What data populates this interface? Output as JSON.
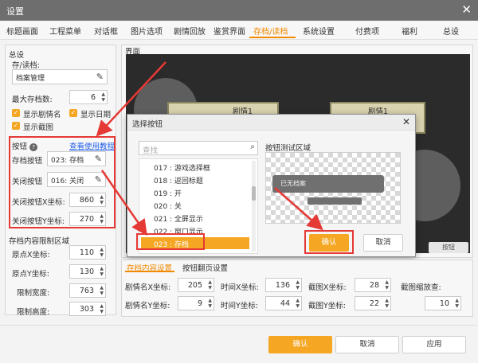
{
  "window": {
    "title": "设置",
    "close_icon": "✕"
  },
  "tabs": [
    {
      "label": "标题画面"
    },
    {
      "label": "工程菜单"
    },
    {
      "label": "对话框"
    },
    {
      "label": "图片选项"
    },
    {
      "label": "剧情回放"
    },
    {
      "label": "鉴赏界面"
    },
    {
      "label": "存档/读档"
    },
    {
      "label": "系统设置"
    },
    {
      "label": "付费项"
    },
    {
      "label": "福利"
    },
    {
      "label": "总设"
    }
  ],
  "active_tab": "存档/读档",
  "left": {
    "section_general": "总设",
    "save_load_label": "存/读档:",
    "save_load_value": "档案管理",
    "max_saves_label": "最大存档数:",
    "max_saves_value": "6",
    "checks": {
      "show_name": "显示剧情名",
      "show_date": "显示日期",
      "show_thumb": "显示截图"
    },
    "button_section": "按钮",
    "help_link": "查看使用教程",
    "save_button_label": "存档按钮",
    "save_button_value": "023: 存档",
    "close_button_label": "关闭按钮",
    "close_button_value": "016: 关闭",
    "close_x_label": "关闭按钮X坐标:",
    "close_x_value": "860",
    "close_y_label": "关闭按钮Y坐标:",
    "close_y_value": "270",
    "limit_section": "存档内容限制区域",
    "origin_x_label": "原点X坐标:",
    "origin_x_value": "110",
    "origin_y_label": "原点Y坐标:",
    "origin_y_value": "130",
    "limit_w_label": "限制宽度:",
    "limit_w_value": "763",
    "limit_h_label": "限制高度:",
    "limit_h_value": "303"
  },
  "preview": {
    "section": "界面",
    "card1": "剧情1",
    "card2": "剧情1",
    "corner_label": "按钮"
  },
  "dialog": {
    "title": "选择按钮",
    "close_icon": "✕",
    "search_placeholder": "查找",
    "search_icon": "🔍",
    "items": [
      {
        "label": "017 : 游戏选择框"
      },
      {
        "label": "018 : 返回标题"
      },
      {
        "label": "019 : 开"
      },
      {
        "label": "020 : 关"
      },
      {
        "label": "021 : 全屏显示"
      },
      {
        "label": "022 : 窗口显示"
      },
      {
        "label": "023 : 存档"
      }
    ],
    "selected": "023 : 存档",
    "test_area_label": "按钮测试区域",
    "test_button_text": "已无档案",
    "confirm": "确认",
    "cancel": "取消"
  },
  "subtabs": {
    "tab1": "存档内容设置",
    "tab2": "按钮翻页设置",
    "row1": [
      {
        "label": "剧情名X坐标:",
        "value": "205"
      },
      {
        "label": "时间X坐标:",
        "value": "136"
      },
      {
        "label": "截图X坐标:",
        "value": "28"
      },
      {
        "label": "截图缩放查:",
        "value": "10"
      }
    ],
    "row2": [
      {
        "label": "剧情名Y坐标:",
        "value": "9"
      },
      {
        "label": "时间Y坐标:",
        "value": "44"
      },
      {
        "label": "截图Y坐标:",
        "value": "22"
      }
    ]
  },
  "footer": {
    "ok": "确认",
    "cancel": "取消",
    "apply": "应用"
  },
  "colors": {
    "accent": "#f5a623",
    "annotation": "#e53935"
  }
}
